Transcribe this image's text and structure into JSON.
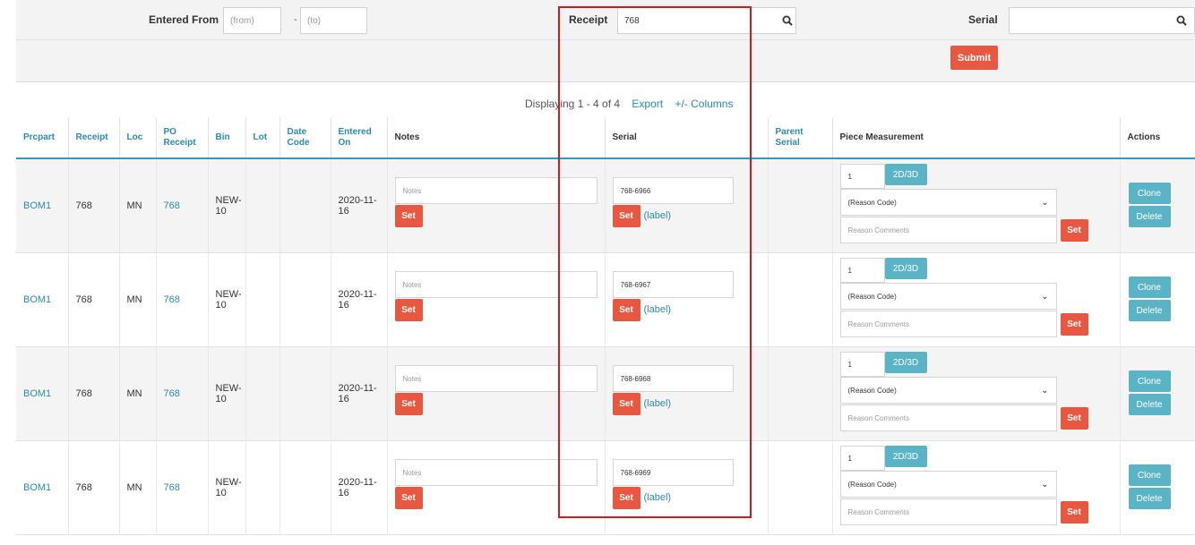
{
  "filters": {
    "entered_from_label": "Entered From",
    "from_placeholder": "(from)",
    "dash": "-",
    "to_placeholder": "(to)",
    "receipt_label": "Receipt",
    "receipt_value": "768",
    "serial_label": "Serial",
    "serial_value": "",
    "submit_label": "Submit"
  },
  "listing": {
    "display_text": "Displaying 1 - 4 of 4",
    "export_label": "Export",
    "columns_label": "+/- Columns"
  },
  "columns": {
    "prcpart": "Prcpart",
    "receipt": "Receipt",
    "loc": "Loc",
    "po_receipt": "PO Receipt",
    "bin": "Bin",
    "lot": "Lot",
    "date_code": "Date Code",
    "entered_on": "Entered On",
    "notes": "Notes",
    "serial": "Serial",
    "parent_serial": "Parent Serial",
    "piece_measurement": "Piece Measurement",
    "actions": "Actions"
  },
  "common": {
    "notes_placeholder": "Notes",
    "set_label": "Set",
    "label_link": "(label)",
    "dim_label": "2D/3D",
    "reason_code": "(Reason Code)",
    "reason_comments_placeholder": "Reason Comments",
    "clone_label": "Clone",
    "delete_label": "Delete"
  },
  "rows": [
    {
      "prcpart": "BOM1",
      "receipt": "768",
      "loc": "MN",
      "po_receipt": "768",
      "bin": "NEW-10",
      "lot": "",
      "date_code": "",
      "entered_on": "2020-11-16",
      "serial": "768-6966",
      "qty": "1"
    },
    {
      "prcpart": "BOM1",
      "receipt": "768",
      "loc": "MN",
      "po_receipt": "768",
      "bin": "NEW-10",
      "lot": "",
      "date_code": "",
      "entered_on": "2020-11-16",
      "serial": "768-6967",
      "qty": "1"
    },
    {
      "prcpart": "BOM1",
      "receipt": "768",
      "loc": "MN",
      "po_receipt": "768",
      "bin": "NEW-10",
      "lot": "",
      "date_code": "",
      "entered_on": "2020-11-16",
      "serial": "768-6968",
      "qty": "1"
    },
    {
      "prcpart": "BOM1",
      "receipt": "768",
      "loc": "MN",
      "po_receipt": "768",
      "bin": "NEW-10",
      "lot": "",
      "date_code": "",
      "entered_on": "2020-11-16",
      "serial": "768-6969",
      "qty": "1"
    }
  ],
  "colors": {
    "accent_button": "#e8573f",
    "action_button": "#5ab4c6",
    "link": "#2a8ab0",
    "header_rule": "#3498bd",
    "highlight_box": "#d8181e"
  }
}
